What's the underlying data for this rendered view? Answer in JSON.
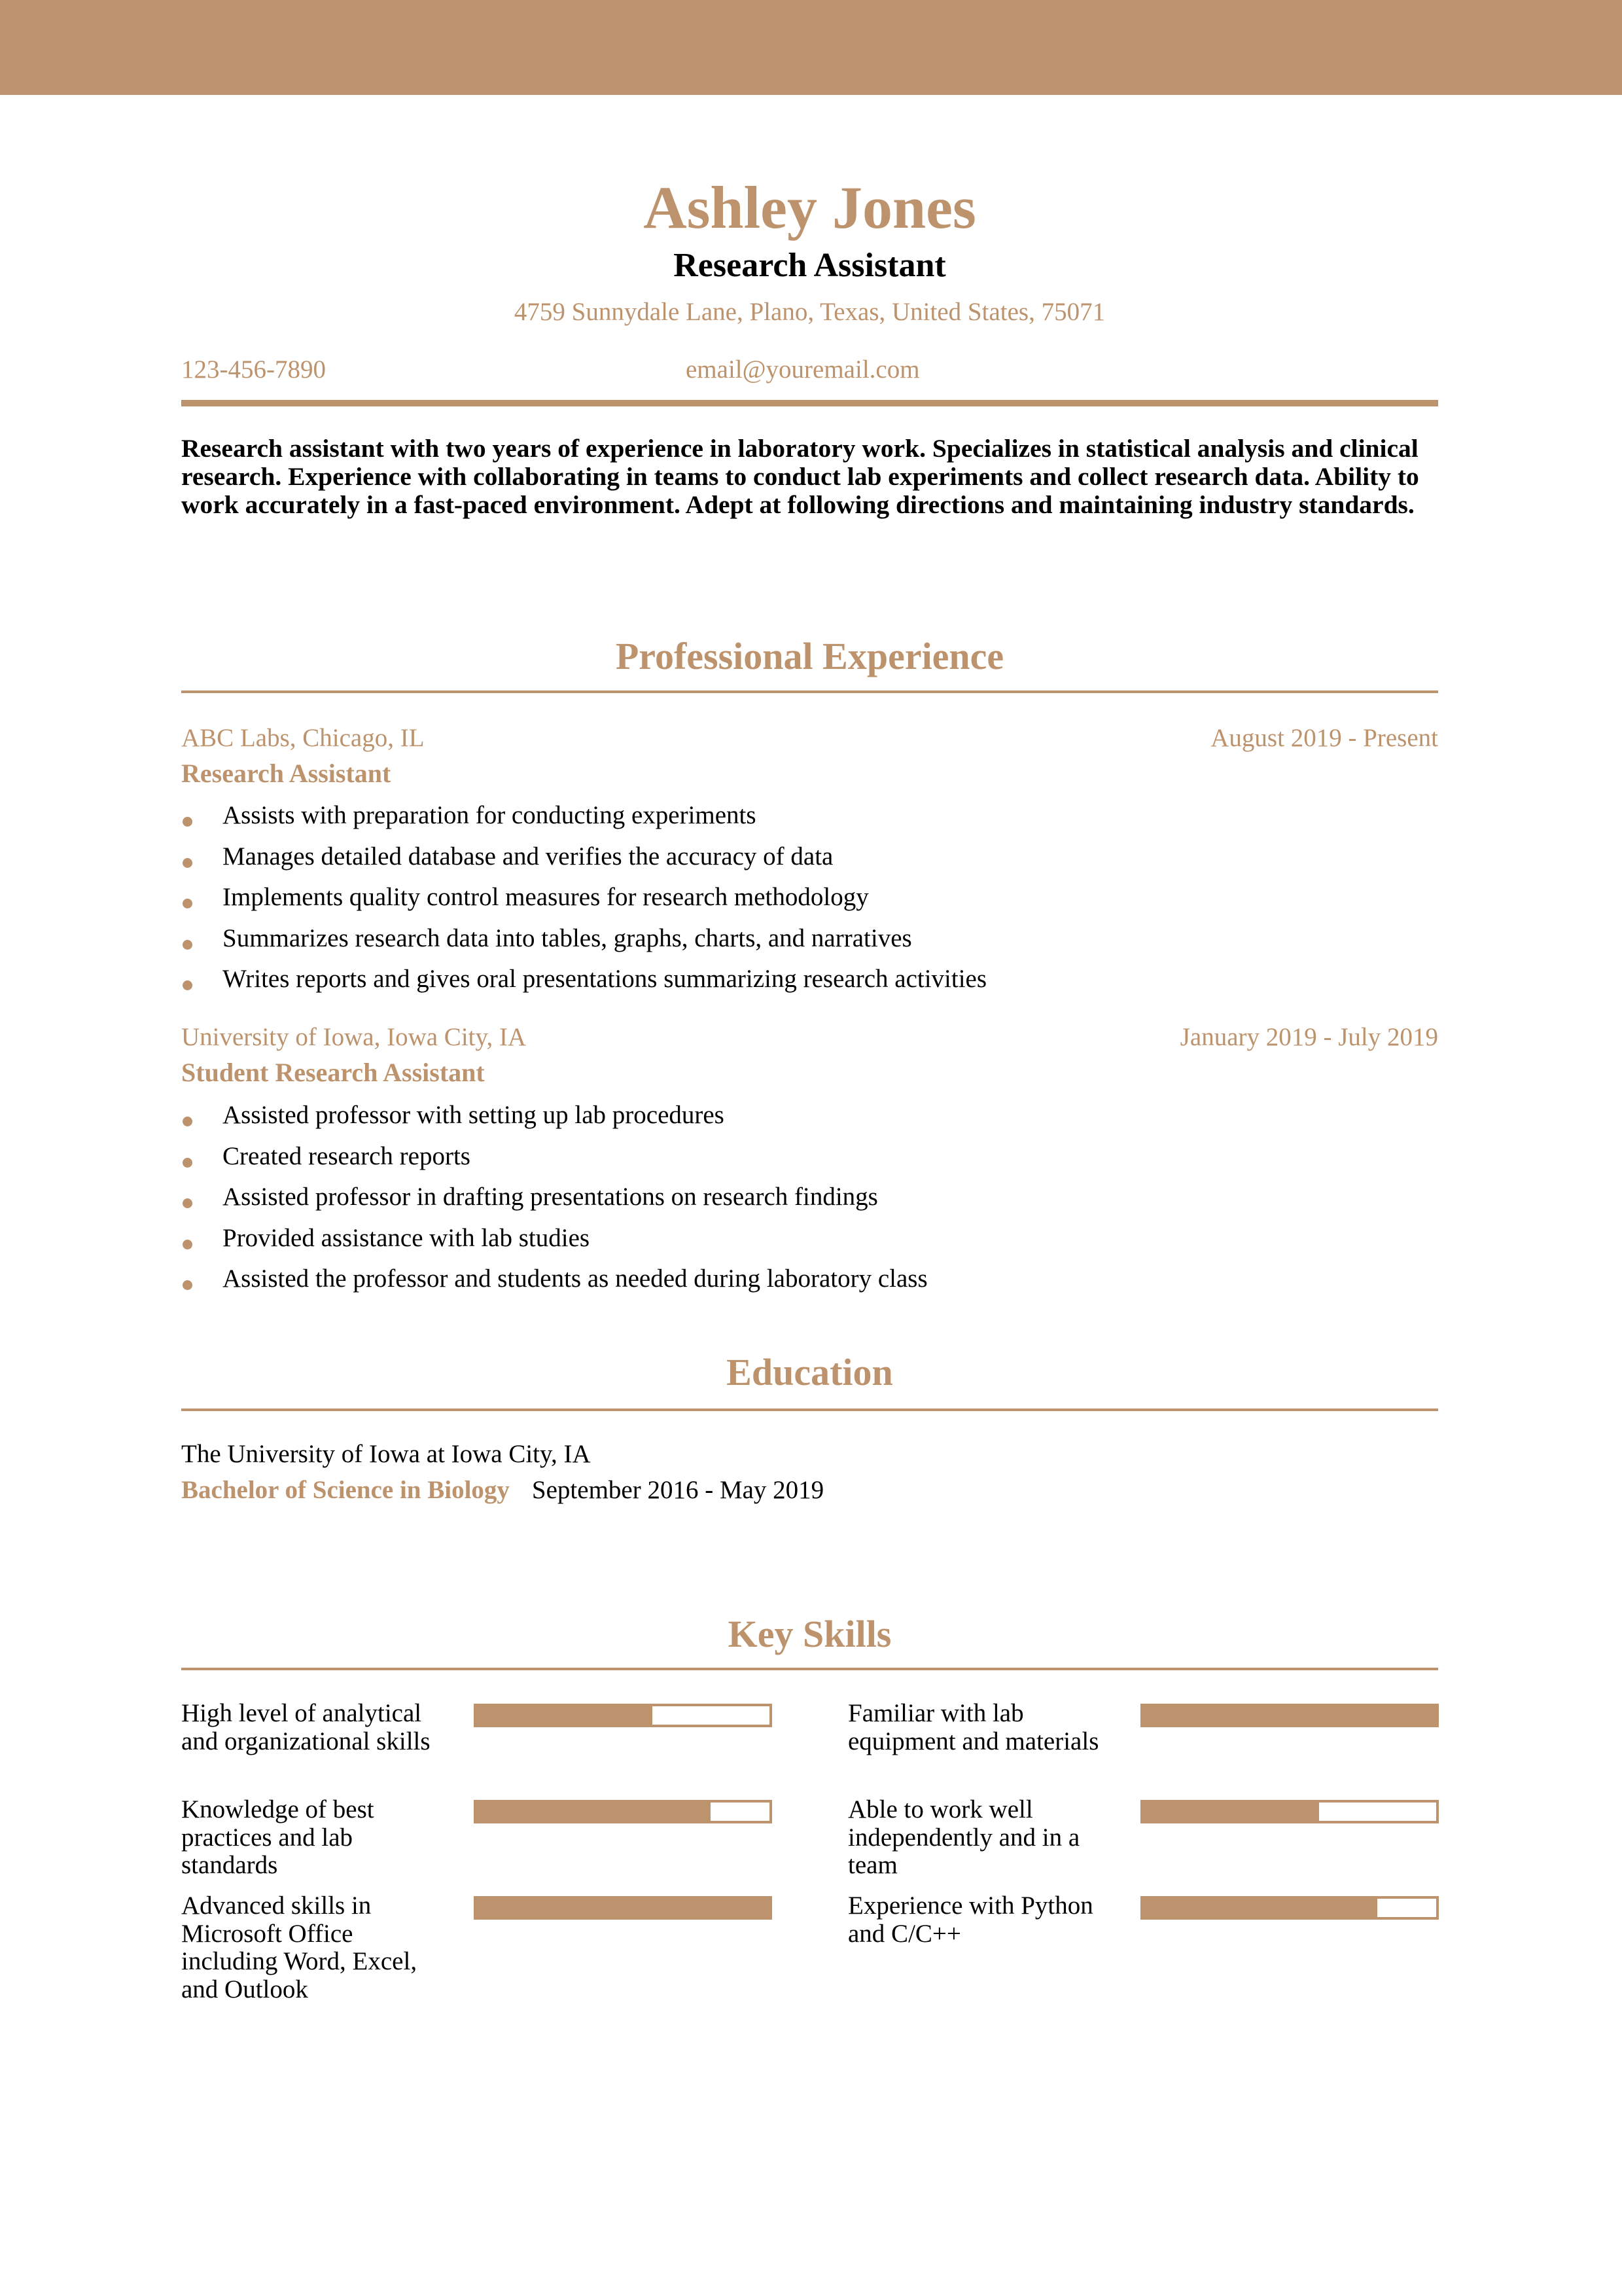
{
  "colors": {
    "accent": "#BD936D",
    "text": "#000000",
    "background": "#FFFFFF"
  },
  "header": {
    "name": "Ashley Jones",
    "role": "Research Assistant",
    "address": "4759 Sunnydale Lane, Plano, Texas, United States, 75071",
    "phone": "123-456-7890",
    "email": "email@youremail.com"
  },
  "summary": "Research assistant with two years of experience in laboratory work. Specializes in statistical analysis and clinical research. Experience with collaborating in teams to conduct lab experiments and collect research data. Ability to work accurately in a fast-paced environment. Adept at following directions and maintaining industry standards.",
  "experience": {
    "title": "Professional Experience",
    "jobs": [
      {
        "company": "ABC Labs, Chicago, IL",
        "dates": "August 2019 - Present",
        "title": "Research Assistant",
        "bullets": [
          "Assists with preparation for conducting experiments",
          "Manages detailed database and verifies the accuracy of data",
          "Implements quality control measures for research methodology",
          "Summarizes research data into tables, graphs, charts, and narratives",
          "Writes reports and gives oral presentations summarizing research activities"
        ]
      },
      {
        "company": "University of Iowa, Iowa City, IA",
        "dates": "January 2019 - July 2019",
        "title": "Student Research Assistant",
        "bullets": [
          "Assisted professor with setting up lab procedures",
          "Created research reports",
          "Assisted professor in drafting presentations on research findings",
          "Provided assistance with lab studies",
          "Assisted the professor and students as needed during laboratory class"
        ]
      }
    ]
  },
  "education": {
    "title": "Education",
    "school": "The University of Iowa at Iowa City, IA",
    "degree": "Bachelor of Science in Biology",
    "dates": "September 2016 - May 2019"
  },
  "skills": {
    "title": "Key Skills",
    "items": [
      {
        "label": "High level of analytical and organizational skills",
        "level": 0.6
      },
      {
        "label": "Familiar with lab equipment and materials",
        "level": 1.0
      },
      {
        "label": "Knowledge of best practices and lab standards",
        "level": 0.8
      },
      {
        "label": "Able to work well independently and in a team",
        "level": 0.6
      },
      {
        "label": "Advanced skills in Microsoft Office including Word, Excel, and Outlook",
        "level": 1.0
      },
      {
        "label": "Experience with Python and C/C++",
        "level": 0.8
      }
    ]
  }
}
